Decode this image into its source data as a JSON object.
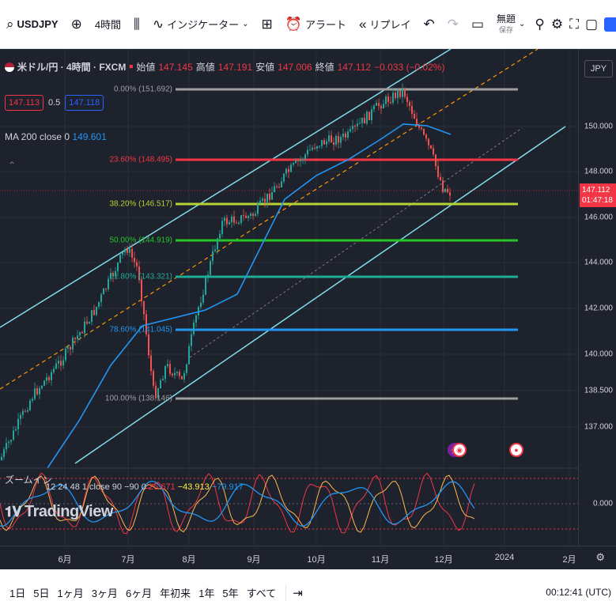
{
  "toolbar": {
    "symbol": "USDJPY",
    "interval": "4時間",
    "indicators": "インジケーター",
    "alert": "アラート",
    "replay": "リプレイ",
    "layout_name": "無題",
    "layout_save": "保存"
  },
  "legend": {
    "title": "米ドル/円 · 4時間 · FXCM",
    "open_label": "始値",
    "open": "147.145",
    "high_label": "高値",
    "high": "147.191",
    "low_label": "安値",
    "low": "147.006",
    "close_label": "終値",
    "close": "147.112",
    "change": "−0.033 (−0.02%)"
  },
  "bidask": {
    "bid": "147.113",
    "spread": "0.5",
    "ask": "147.118"
  },
  "ma": {
    "label": "MA 200 close 0",
    "value": "149.601"
  },
  "price_axis": {
    "currency": "JPY",
    "labels": [
      "150.000",
      "148.000",
      "146.000",
      "144.000",
      "142.000",
      "140.000",
      "138.500",
      "137.000"
    ],
    "current_price": "147.112",
    "countdown": "01:47:18"
  },
  "fib_levels": [
    {
      "label": "0.00% (151.692)",
      "color": "#9e9e9e"
    },
    {
      "label": "23.60% (148.495)",
      "color": "#f23645"
    },
    {
      "label": "38.20% (146.517)",
      "color": "#b5d334"
    },
    {
      "label": "50.00% (144.919)",
      "color": "#26c526"
    },
    {
      "label": "61.80% (143.321)",
      "color": "#22ab94"
    },
    {
      "label": "78.60% (141.045)",
      "color": "#2196f3"
    },
    {
      "label": "100.00% (138.146)",
      "color": "#9e9e9e"
    }
  ],
  "oscillator": {
    "params": "12 24 48 1 close 90 −90 0",
    "v1": "26.671",
    "v2": "−43.913",
    "v3": "−79.917",
    "axis_label": "0.000"
  },
  "zoom_label": "ズームイン",
  "logo": "TradingView",
  "time_axis": [
    "6月",
    "7月",
    "8月",
    "9月",
    "10月",
    "11月",
    "12月",
    "2024",
    "2月"
  ],
  "bottom": {
    "ranges": [
      "1日",
      "5日",
      "1ヶ月",
      "3ヶ月",
      "6ヶ月",
      "年初来",
      "1年",
      "5年",
      "すべて"
    ],
    "clock": "00:12:41 (UTC)"
  }
}
